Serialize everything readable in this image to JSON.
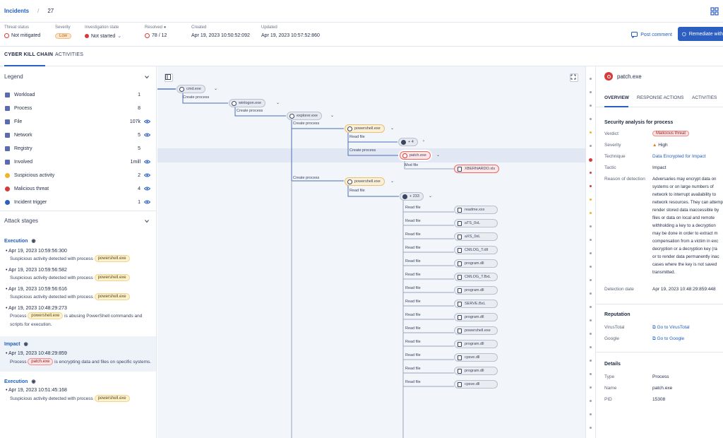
{
  "breadcrumb": {
    "parent": "Incidents",
    "current": "27"
  },
  "info": {
    "threat_status_label": "Threat status",
    "threat_status_value": "Not mitigated",
    "severity_label": "Severity",
    "severity_value": "Low",
    "investigation_state_label": "Investigation state",
    "investigation_state_value": "Not started",
    "resolved_label": "Resolved",
    "resolved_value": "78 / 12",
    "created_label": "Created",
    "created_value": "Apr 19, 2023 10:50:52:092",
    "updated_label": "Updated",
    "updated_value": "Apr 19, 2023 10:57:52:860"
  },
  "actions": {
    "post_comment": "Post comment",
    "remediate": "Remediate with"
  },
  "tabs": [
    {
      "label": "CYBER KILL CHAIN"
    },
    {
      "label": "ACTIVITIES"
    }
  ],
  "legend": {
    "title": "Legend",
    "items": [
      {
        "name": "Workload",
        "count": "1",
        "color": "#5a6bb0",
        "icon": "workload-icon"
      },
      {
        "name": "Process",
        "count": "8",
        "color": "#5a6bb0",
        "icon": "process-icon"
      },
      {
        "name": "File",
        "count": "107k",
        "color": "#5a6bb0",
        "icon": "file-icon"
      },
      {
        "name": "Network",
        "count": "5",
        "color": "#5a6bb0",
        "icon": "network-icon"
      },
      {
        "name": "Registry",
        "count": "5",
        "color": "#5a6bb0",
        "icon": "registry-icon"
      },
      {
        "name": "Involved",
        "count": "1mill",
        "color": "#5a6bb0",
        "icon": "involved-icon"
      },
      {
        "name": "Suspicious activity",
        "count": "2",
        "color": "#f0b429",
        "icon": "suspicious-icon"
      },
      {
        "name": "Malicious threat",
        "count": "4",
        "color": "#d63a3a",
        "icon": "malicious-icon"
      },
      {
        "name": "Incident trigger",
        "count": "1",
        "color": "#2c5fbf",
        "icon": "trigger-icon"
      }
    ]
  },
  "stages": {
    "title": "Attack stages",
    "groups": [
      {
        "title": "Execution",
        "events": [
          {
            "time": "Apr 19, 2023 10:59:56:300",
            "text": "Suspicious activity detected with process",
            "chip": "powershell.exe"
          },
          {
            "time": "Apr 19, 2023 10:59:56:582",
            "text": "Suspicious activity detected with process",
            "chip": "powershell.exe"
          },
          {
            "time": "Apr 19, 2023 10:59:56:616",
            "text": "Suspicious activity detected with process",
            "chip": "powershell.exe"
          },
          {
            "time": "Apr 19, 2023 10:48:29:273",
            "text_pre": "Process",
            "chip": "powershell.exe",
            "text_post": "is abusing PowerShell commands and",
            "text2": "scripts for execution."
          }
        ]
      },
      {
        "title": "Impact",
        "events": [
          {
            "time": "Apr 19, 2023 10:48:29:859",
            "text_pre": "Process",
            "chip": "patch.exe",
            "text_post": "is encrypting data and files on specific systems."
          }
        ]
      },
      {
        "title": "Execution",
        "events": [
          {
            "time": "Apr 19, 2023 10:51:45:168",
            "text": "Suspicious activity detected with process",
            "chip": "powershell.exe"
          }
        ]
      }
    ]
  },
  "graph": {
    "n1": "cmd.exe",
    "n2": "winlogon.exe",
    "n3": "explorer.exe",
    "n4": "powershell.exe",
    "n5": "+ 4",
    "n6": "patch.exe",
    "n7": "powershell.exe",
    "n8": "+ 233",
    "e_create": "Create process",
    "e_read": "Read file",
    "e_mod": "Mod file",
    "mal_file": "XBERNARDO.xls",
    "files": [
      "readme.xxx",
      "aTS_0xL",
      "aXS_0xL",
      "CMLOG_T.dll",
      "program.dll",
      "CMLOG_T.BxL",
      "program.dll",
      "SERVE.BxL",
      "program.dll",
      "powershell.exe",
      "program.dll",
      "cpsve.dll",
      "program.dll",
      "cpsve.dll"
    ]
  },
  "detail": {
    "title": "patch.exe",
    "tabs": [
      "OVERVIEW",
      "RESPONSE ACTIONS",
      "ACTIVITIES"
    ],
    "security_head": "Security analysis for process",
    "verdict_k": "Verdict",
    "verdict_v": "Malicious threat",
    "severity_k": "Severity",
    "severity_v": "High",
    "technique_k": "Technique",
    "technique_v": "Data Encrypted for Impact",
    "tactic_k": "Tactic",
    "tactic_v": "Impact",
    "reason_k": "Reason of detection",
    "reason_lines": [
      "Adversaries may encrypt data on",
      "systems or on large numbers of",
      "network to interrupt availability to",
      "network resources. They can attempt",
      "render stored data inaccessible by",
      "files or data on local and remote",
      "withholding a key to a decryption",
      "may be done in order to extract m",
      "compensation from a victim in exc",
      "decryption or a decryption key (ra",
      "or to render data permanently inac",
      "cases where the key is not saved",
      "transmitted."
    ],
    "detection_k": "Detection date",
    "detection_v": "Apr 19, 2023 10:48:29:859:448",
    "reputation_head": "Reputation",
    "vt_k": "VirusTotal",
    "vt_v": "Go to VirusTotal",
    "google_k": "Google",
    "google_v": "Go to Google",
    "details_head": "Details",
    "type_k": "Type",
    "type_v": "Process",
    "name_k": "Name",
    "name_v": "patch.exe",
    "pid_k": "PID",
    "pid_v": "15308"
  }
}
